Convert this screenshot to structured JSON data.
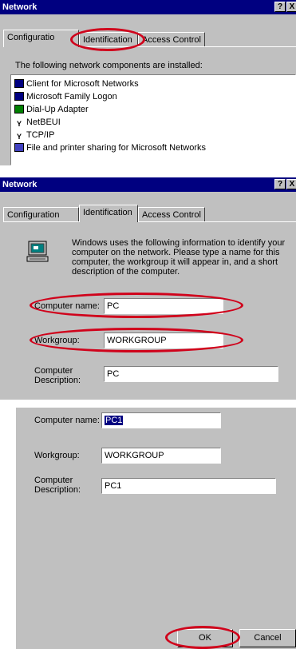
{
  "panel1": {
    "title": "Network",
    "help_button": "?",
    "close_button": "X",
    "tabs": [
      "Configuratio",
      "Identification",
      "Access Control"
    ],
    "list_caption": "The following network components are installed:",
    "components": [
      {
        "label": "Client for Microsoft Networks",
        "icon": "network-client-icon"
      },
      {
        "label": "Microsoft Family Logon",
        "icon": "network-client-icon"
      },
      {
        "label": "Dial-Up Adapter",
        "icon": "network-adapter-icon"
      },
      {
        "label": "NetBEUI",
        "icon": "network-protocol-icon"
      },
      {
        "label": "TCP/IP",
        "icon": "network-protocol-icon"
      },
      {
        "label": "File and printer sharing for Microsoft Networks",
        "icon": "network-service-icon"
      }
    ]
  },
  "panel2": {
    "title": "Network",
    "help_button": "?",
    "close_button": "X",
    "tabs": [
      "Configuration",
      "Identification",
      "Access Control"
    ],
    "description": "Windows uses the following information to identify your computer on the network.  Please type a name for this computer, the workgroup it will appear in, and a short description of the computer.",
    "computer_name_label": "Computer name:",
    "computer_name_value": "PC",
    "workgroup_label": "Workgroup:",
    "workgroup_value": "WORKGROUP",
    "description_label_line1": "Computer",
    "description_label_line2": "Description:",
    "description_value": "PC"
  },
  "panel3": {
    "computer_name_label": "Computer name:",
    "computer_name_value": "PC1",
    "workgroup_label": "Workgroup:",
    "workgroup_value": "WORKGROUP",
    "description_label_line1": "Computer",
    "description_label_line2": "Description:",
    "description_value": "PC1",
    "ok_label": "OK",
    "cancel_label": "Cancel"
  },
  "colors": {
    "titlebar": "#000080",
    "dialog_face": "#c0c0c0",
    "highlight_ellipse": "#d0021b"
  }
}
